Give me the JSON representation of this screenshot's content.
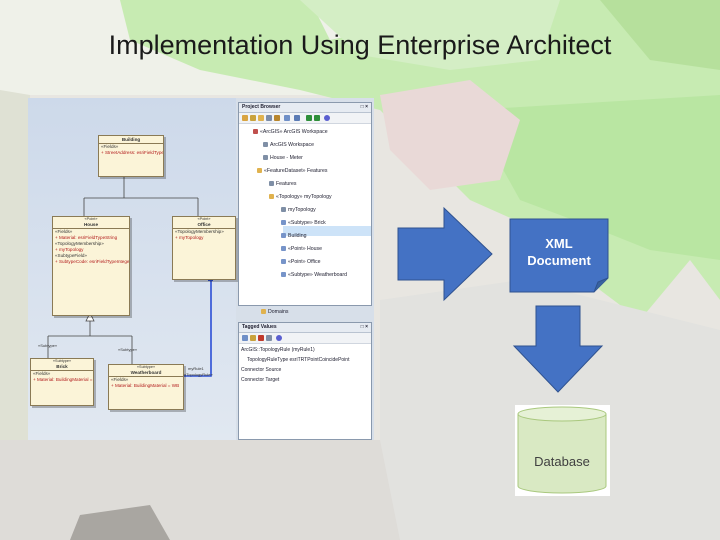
{
  "slide": {
    "title": "Implementation Using Enterprise Architect"
  },
  "flow": {
    "xml_line1": "XML",
    "xml_line2": "Document",
    "database": "Database"
  },
  "screenshot": {
    "classes": {
      "building": {
        "name": "Building",
        "section": "«Fields»",
        "attr": "+ StreetAddress: esriFieldTypeString"
      },
      "house": {
        "stereotype": "«Point»",
        "name": "House",
        "section": "«Fields»",
        "attr1": "+ Material: esriFieldTypeString",
        "section2": "«TopologyMembership»",
        "attr2": "+ myTopology",
        "section3": "«SubtypeField»",
        "attr3": "+ SubtypeCode: esriFieldTypeInteger = 1"
      },
      "office": {
        "stereotype": "«Point»",
        "name": "Office",
        "section": "«TopologyMembership»",
        "attr": "+ myTopology"
      },
      "brick": {
        "stereotype": "«Subtype»",
        "name": "Brick",
        "section": "«Fields»",
        "attr": "+ Material: BuildingMaterial = BR"
      },
      "weatherboard": {
        "stereotype": "«Subtype»",
        "name": "Weatherboard",
        "section": "«Fields»",
        "attr": "+ Material: BuildingMaterial = WB"
      }
    },
    "labels": {
      "subtype_left": "«Subtype»",
      "subtype_right": "«Subtype»",
      "rule": "myRule1",
      "rule_stereo": "«TopologyRule»"
    },
    "project_browser": {
      "title": "Project Browser",
      "controls": "□ ×",
      "items": [
        "«ArcGIS» ArcGIS Workspace",
        "ArcGIS Workspace",
        "House - Meter",
        "«FeatureDataset» Features",
        "Features",
        "«Topology» myTopology",
        "myTopology",
        "«Subtype» Brick",
        "Building",
        "«Point» House",
        "«Point» Office",
        "«Subtype» Weatherboard",
        "Domains"
      ]
    },
    "tagged_values": {
      "title": "Tagged Values",
      "controls": "□ ×",
      "rows": [
        "ArcGIS::TopologyRule (myRule1)",
        "TopologyRuleType    esriTRTPointCoincidePoint",
        "Connector Source",
        "Connector Target"
      ]
    }
  },
  "colors": {
    "shape_blue": "#4472c4",
    "shape_border": "#2f528f",
    "db_fill": "#d9e9c3",
    "db_text": "#404040",
    "connector": "#2c4fd6"
  }
}
